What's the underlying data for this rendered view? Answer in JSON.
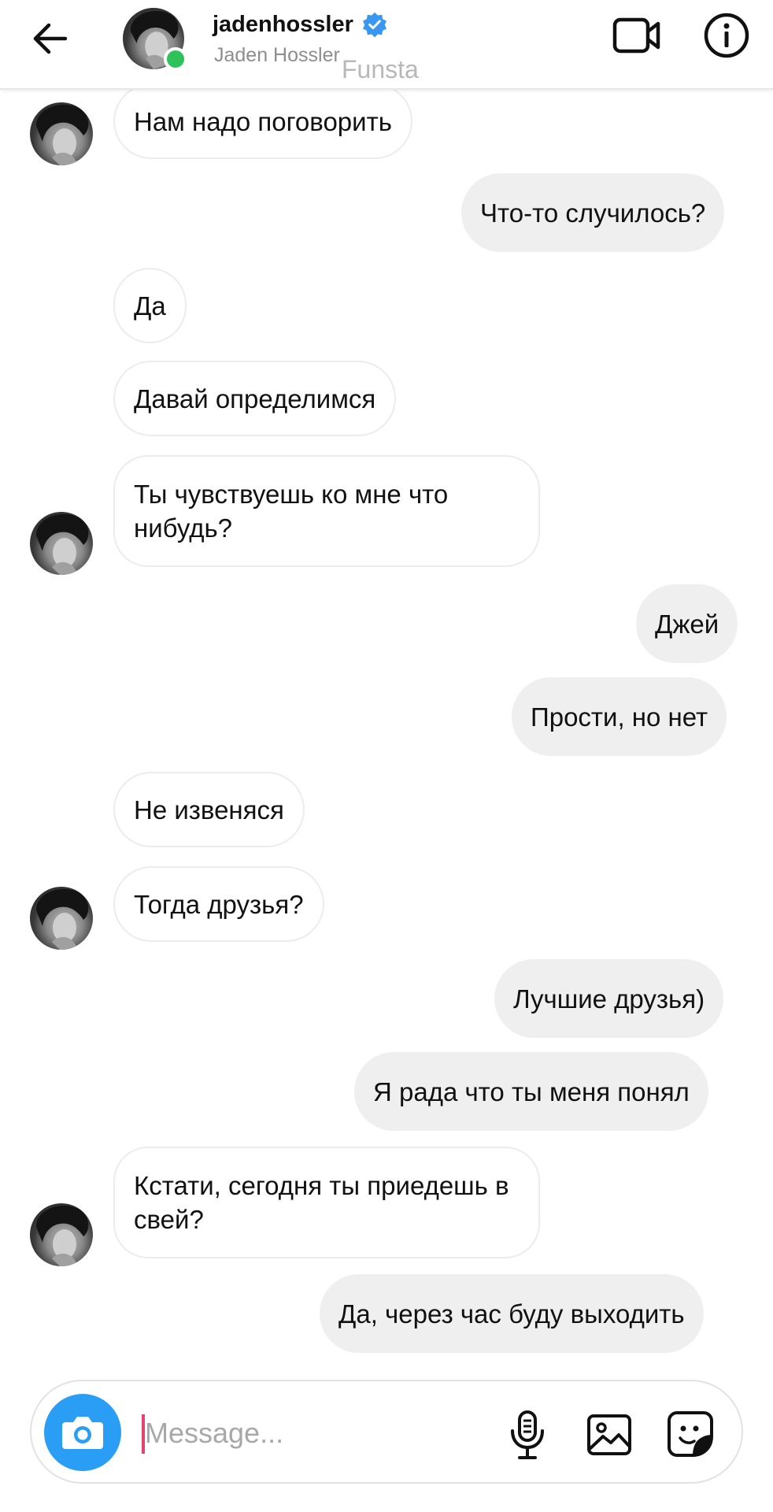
{
  "header": {
    "username": "jadenhossler",
    "full_name": "Jaden Hossler",
    "verified": true,
    "online": true,
    "watermark": "Funsta",
    "colors": {
      "verified_badge": "#3897f0",
      "online_dot": "#2fc25b"
    }
  },
  "messages": [
    {
      "sender": "them",
      "text": "Нам надо поговорить",
      "avatar": true
    },
    {
      "sender": "me",
      "text": "Что-то случилось?"
    },
    {
      "sender": "them",
      "text": "Да",
      "avatar": false
    },
    {
      "sender": "them",
      "text": "Давай определимся",
      "avatar": false
    },
    {
      "sender": "them",
      "text": "Ты чувствуешь ко мне что нибудь?",
      "avatar": true
    },
    {
      "sender": "me",
      "text": "Джей"
    },
    {
      "sender": "me",
      "text": "Прости, но нет"
    },
    {
      "sender": "them",
      "text": "Не извеняся",
      "avatar": false
    },
    {
      "sender": "them",
      "text": "Тогда друзья?",
      "avatar": true
    },
    {
      "sender": "me",
      "text": "Лучшие друзья)"
    },
    {
      "sender": "me",
      "text": "Я рада что ты меня понял"
    },
    {
      "sender": "them",
      "text": "Кстати, сегодня ты приедешь в свей?",
      "avatar": true
    },
    {
      "sender": "me",
      "text": "Да, через час буду выходить"
    }
  ],
  "composer": {
    "placeholder": "Message...",
    "value": "",
    "camera_color": "#2a9df4",
    "caret_color": "#e2456e"
  },
  "icons": {
    "back": "arrow-left",
    "video": "video-camera",
    "info": "info-circle",
    "camera": "camera",
    "mic": "microphone",
    "gallery": "image",
    "sticker": "sticker"
  }
}
